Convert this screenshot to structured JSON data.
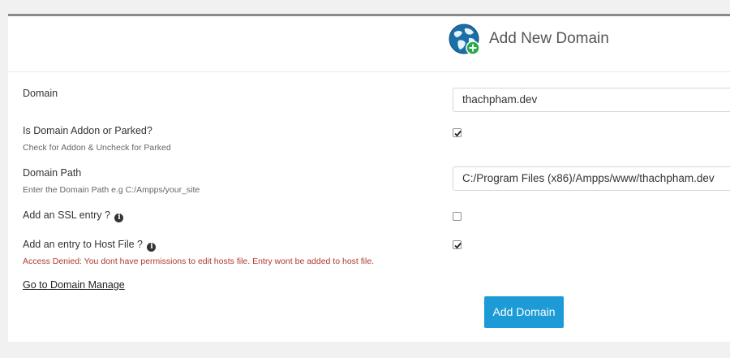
{
  "header": {
    "title": "Add New Domain",
    "icon": "globe-add-icon"
  },
  "form": {
    "domain": {
      "label": "Domain",
      "value": "thachpham.dev"
    },
    "addon_parked": {
      "label": "Is Domain Addon or Parked?",
      "hint": "Check for Addon & Uncheck for Parked",
      "checked": true
    },
    "domain_path": {
      "label": "Domain Path",
      "hint": "Enter the Domain Path e.g C:/Ampps/your_site",
      "value": "C:/Program Files (x86)/Ampps/www/thachpham.dev"
    },
    "ssl_entry": {
      "label": "Add an SSL entry ?",
      "checked": false
    },
    "host_file": {
      "label": "Add an entry to Host File ?",
      "error": "Access Denied: You dont have permissions to edit hosts file. Entry wont be added to host file.",
      "checked": true
    }
  },
  "links": {
    "manage": "Go to Domain Manage"
  },
  "actions": {
    "submit_label": "Add Domain"
  },
  "colors": {
    "accent": "#1d9bd6",
    "error": "#b03a2e",
    "globe": "#1b6fa8",
    "plus_badge": "#27a84a"
  }
}
